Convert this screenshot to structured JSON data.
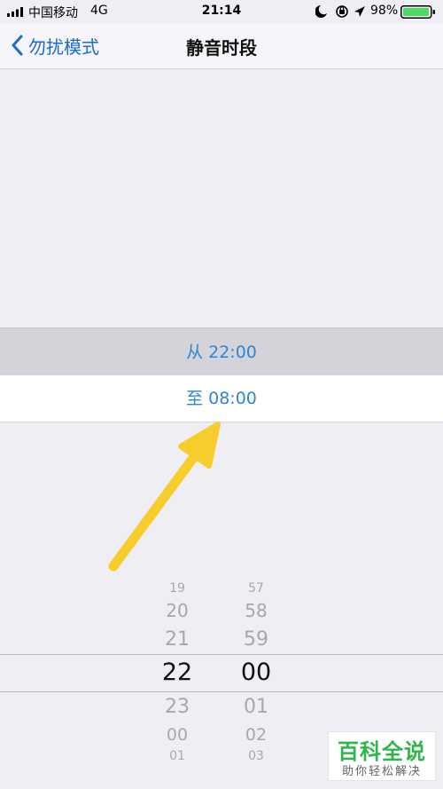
{
  "status_bar": {
    "carrier": "中国移动",
    "network": "4G",
    "time": "21:14",
    "battery_percent": "98%",
    "icons": [
      "signal-bars-icon",
      "moon-icon",
      "rotation-lock-icon",
      "location-arrow-icon",
      "battery-icon"
    ]
  },
  "nav": {
    "back_label": "勿扰模式",
    "title": "静音时段"
  },
  "schedule": {
    "from_label": "从 22:00",
    "to_label": "至 08:00"
  },
  "picker": {
    "hours": [
      "19",
      "20",
      "21",
      "22",
      "23",
      "00",
      "01"
    ],
    "minutes": [
      "57",
      "58",
      "59",
      "00",
      "01",
      "02",
      "03"
    ],
    "selected_hour": "22",
    "selected_minute": "00"
  },
  "watermark": {
    "main": "百科全说",
    "sub": "助你轻松解决"
  },
  "colors": {
    "accent": "#1a6ad8",
    "time_text": "#2e86d6",
    "arrow": "#f7cd2c",
    "watermark": "#2fb64a"
  }
}
